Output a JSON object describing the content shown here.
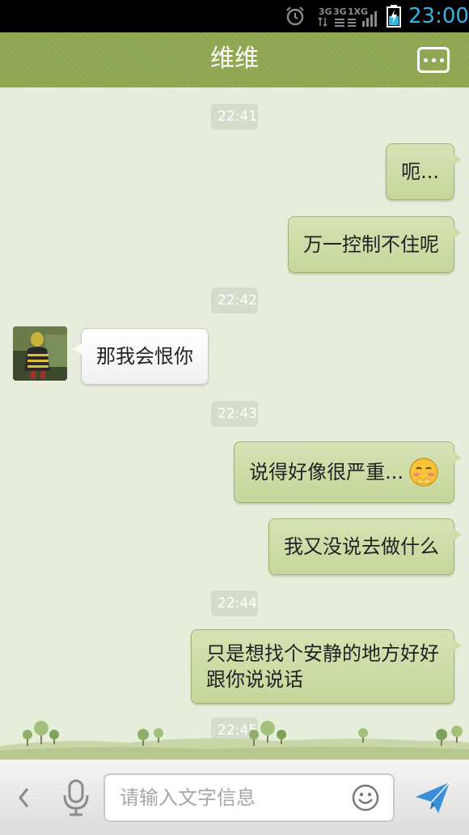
{
  "status_bar": {
    "time": "23:00",
    "network_label": "3G",
    "icons": [
      "alarm-icon",
      "network-icon",
      "signal-icon",
      "battery-charging-icon"
    ]
  },
  "header": {
    "title": "维维",
    "menu_icon": "more-dots-icon"
  },
  "messages": [
    {
      "type": "timestamp",
      "text": "22:41"
    },
    {
      "type": "outgoing",
      "text": "呃..."
    },
    {
      "type": "outgoing",
      "text": "万一控制不住呢"
    },
    {
      "type": "timestamp",
      "text": "22:42"
    },
    {
      "type": "incoming",
      "text": "那我会恨你"
    },
    {
      "type": "timestamp",
      "text": "22:43"
    },
    {
      "type": "outgoing",
      "text": "说得好像很严重...",
      "emoji": "blushing-face-emoji"
    },
    {
      "type": "outgoing",
      "text": "我又没说去做什么"
    },
    {
      "type": "timestamp",
      "text": "22:44"
    },
    {
      "type": "outgoing",
      "line1": "只是想找个安静的地方好好",
      "line2": "跟你说说话"
    },
    {
      "type": "timestamp",
      "text": "22:45"
    }
  ],
  "input_bar": {
    "placeholder": "请输入文字信息",
    "value": "",
    "back_icon": "chevron-left-icon",
    "voice_icon": "microphone-icon",
    "emoji_icon": "smiley-icon",
    "send_icon": "send-icon"
  },
  "colors": {
    "header_green": "#8fa650",
    "chat_background": "#e7eddb",
    "outgoing_bubble": "#cfdca8",
    "incoming_bubble": "#ffffff",
    "status_time": "#33b5e5",
    "send_blue": "#3a8fd8"
  }
}
